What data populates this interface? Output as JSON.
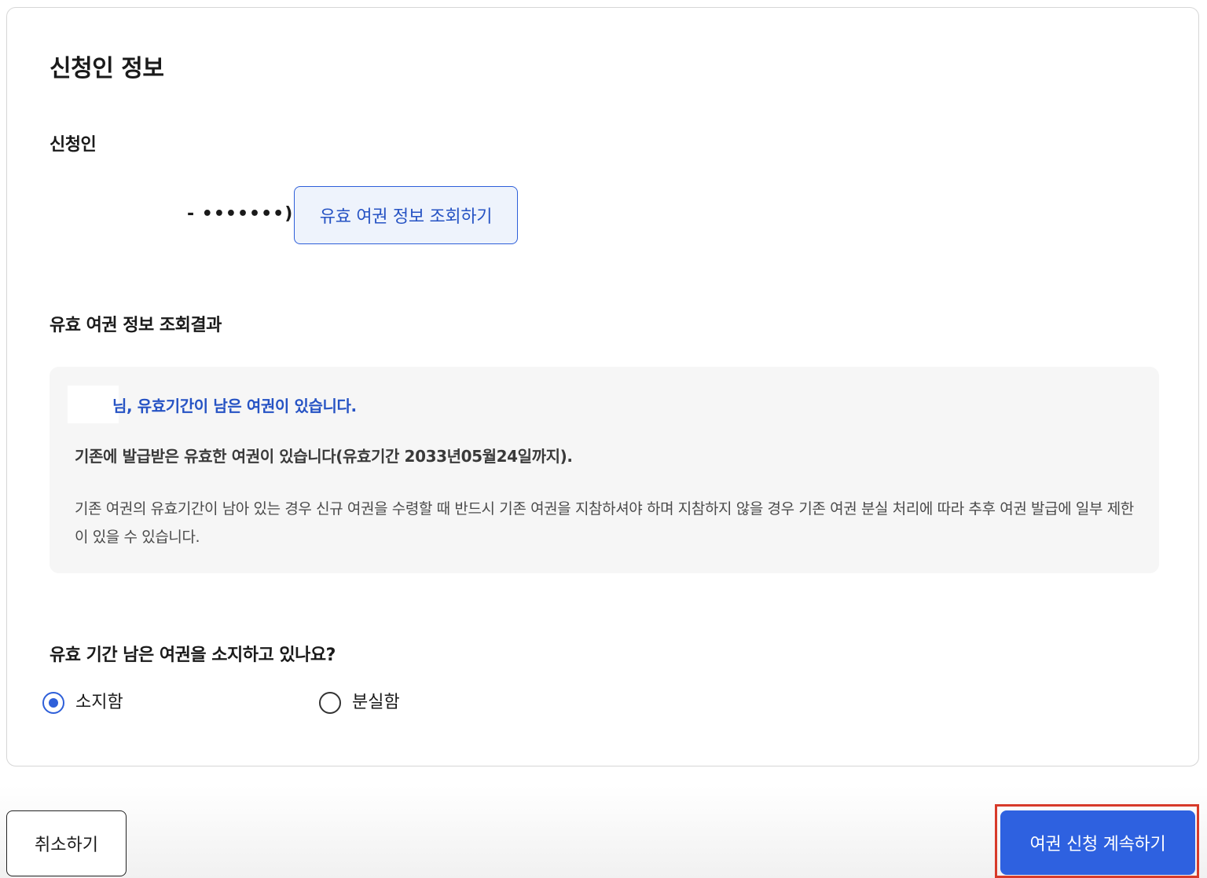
{
  "section": {
    "title": "신청인 정보",
    "applicant_label": "신청인",
    "masked_id": "- •••••••)",
    "lookup_button_label": "유효 여권 정보 조회하기"
  },
  "result": {
    "heading": "유효 여권 정보 조회결과",
    "notice_title": "님, 유효기간이 남은 여권이 있습니다.",
    "valid_until_text": "기존에 발급받은 유효한 여권이 있습니다(유효기간 2033년05월24일까지).",
    "description": "기존 여권의 유효기간이 남아 있는 경우 신규 여권을 수령할 때 반드시 기존 여권을 지참하셔야 하며 지참하지 않을 경우 기존 여권 분실 처리에 따라 추후 여권 발급에 일부 제한이 있을 수 있습니다."
  },
  "question": {
    "text": "유효 기간 남은 여권을 소지하고 있나요?",
    "options": [
      {
        "label": "소지함",
        "selected": true
      },
      {
        "label": "분실함",
        "selected": false
      }
    ]
  },
  "footer": {
    "cancel_label": "취소하기",
    "continue_label": "여권 신청 계속하기"
  },
  "colors": {
    "accent": "#2e61e0",
    "highlight_border": "#d73a2a"
  }
}
